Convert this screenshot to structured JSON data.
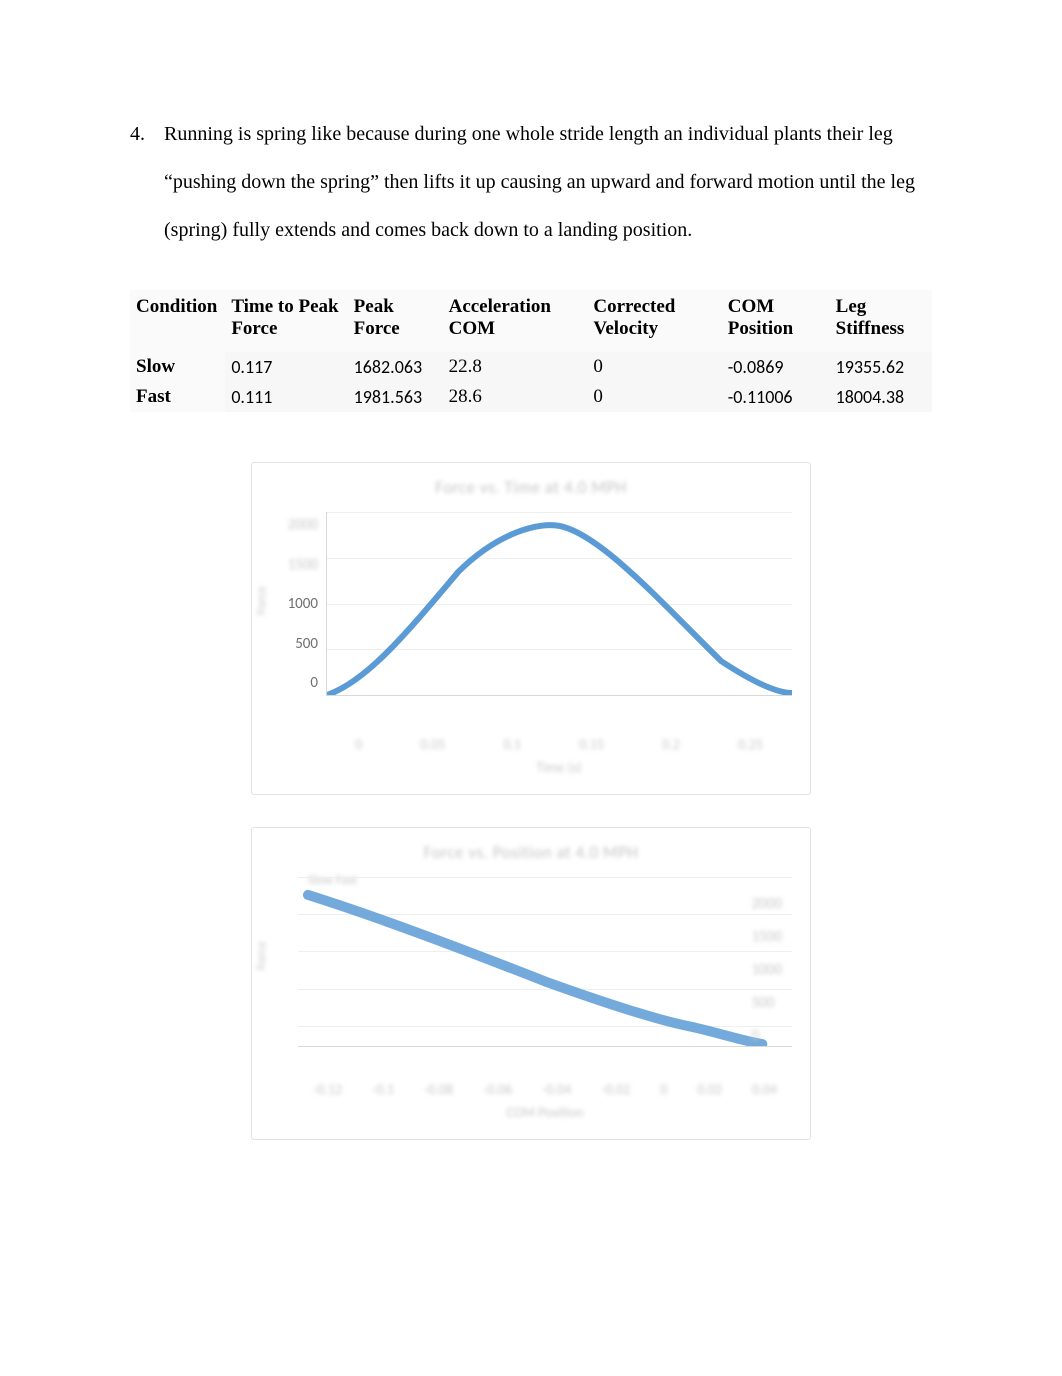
{
  "list": {
    "number": "4.",
    "text": "Running is spring like because during one whole stride length an individual plants their leg “pushing down the spring” then lifts it up causing an upward and forward motion until the leg (spring) fully extends and comes back down to a landing position."
  },
  "table": {
    "headers": [
      "Condition",
      "Time to Peak Force",
      "Peak Force",
      "Acceleration COM",
      "Corrected Velocity",
      "COM Position",
      "Leg Stiffness"
    ],
    "rows": [
      {
        "label": "Slow",
        "cells": [
          "0.117",
          "1682.063",
          "22.8",
          "0",
          "-0.0869",
          "19355.62"
        ]
      },
      {
        "label": "Fast",
        "cells": [
          "0.111",
          "1981.563",
          "28.6",
          "0",
          "-0.11006",
          "18004.38"
        ]
      }
    ]
  },
  "chart_data": [
    {
      "type": "line",
      "title": "Force vs. Time at 4.0 MPH",
      "xlabel": "Time (s)",
      "ylabel": "Force",
      "x_ticks": [
        "0",
        "0.05",
        "0.1",
        "0.15",
        "0.2",
        "0.25"
      ],
      "y_ticks_visible": [
        "1000",
        "500",
        "0"
      ],
      "y_ticks_blurred_top": [
        "2000",
        "1500"
      ],
      "ylim": [
        0,
        2000
      ],
      "series": [
        {
          "name": "Force",
          "color": "#5b9bd5",
          "x": [
            0,
            0.025,
            0.05,
            0.075,
            0.1,
            0.117,
            0.14,
            0.17,
            0.2,
            0.225,
            0.25
          ],
          "y": [
            0,
            350,
            900,
            1350,
            1620,
            1682,
            1600,
            1280,
            780,
            320,
            40
          ]
        }
      ]
    },
    {
      "type": "line",
      "title": "Force vs. Position at 4.0 MPH",
      "xlabel": "COM Position",
      "ylabel": "Force",
      "x_ticks": [
        "-0.12",
        "-0.1",
        "-0.08",
        "-0.06",
        "-0.04",
        "-0.02",
        "0",
        "0.02",
        "0.04"
      ],
      "y_ticks": [
        "2000",
        "1500",
        "1000",
        "500",
        "0"
      ],
      "ylim": [
        0,
        2000
      ],
      "legend": "Slow  Fast",
      "series": [
        {
          "name": "combined",
          "color": "#5b9bd5",
          "x": [
            -0.12,
            -0.1,
            -0.08,
            -0.06,
            -0.04,
            -0.02,
            0.0,
            0.02,
            0.04
          ],
          "y": [
            1900,
            1650,
            1400,
            1150,
            900,
            600,
            300,
            120,
            0
          ]
        }
      ]
    }
  ]
}
